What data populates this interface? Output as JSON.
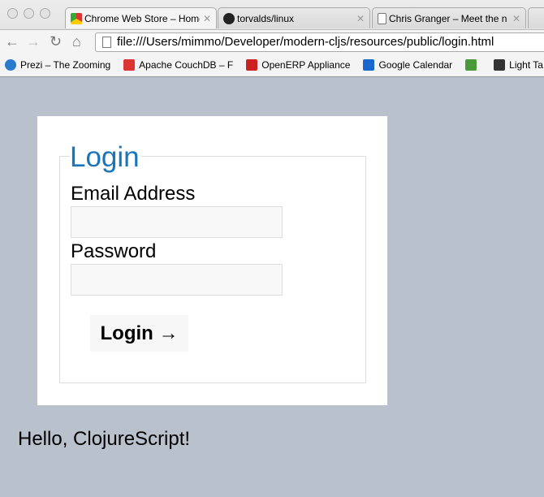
{
  "browser": {
    "tabs": [
      {
        "title": "Chrome Web Store – Home",
        "icon": "chrome-web-store-icon"
      },
      {
        "title": "torvalds/linux",
        "icon": "github-icon"
      },
      {
        "title": "Chris Granger – Meet the n",
        "icon": "page-icon"
      }
    ],
    "url": "file:///Users/mimmo/Developer/modern-cljs/resources/public/login.html",
    "bookmarks": [
      {
        "label": "Prezi – The Zooming",
        "color": "#2a7bd0"
      },
      {
        "label": "Apache CouchDB – F",
        "color": "#d33"
      },
      {
        "label": "OpenERP Appliance",
        "color": "#c22"
      },
      {
        "label": "Google Calendar",
        "color": "#1a66cc"
      },
      {
        "label": "",
        "color": "#4a9a3a"
      },
      {
        "label": "Light Ta",
        "color": "#333"
      }
    ]
  },
  "form": {
    "legend": "Login",
    "email_label": "Email Address",
    "email_value": "",
    "password_label": "Password",
    "password_value": "",
    "submit_label": "Login →"
  },
  "footer_text": "Hello, ClojureScript!",
  "colors": {
    "accent": "#1a75bb",
    "page_bg": "#b9c2cc"
  }
}
